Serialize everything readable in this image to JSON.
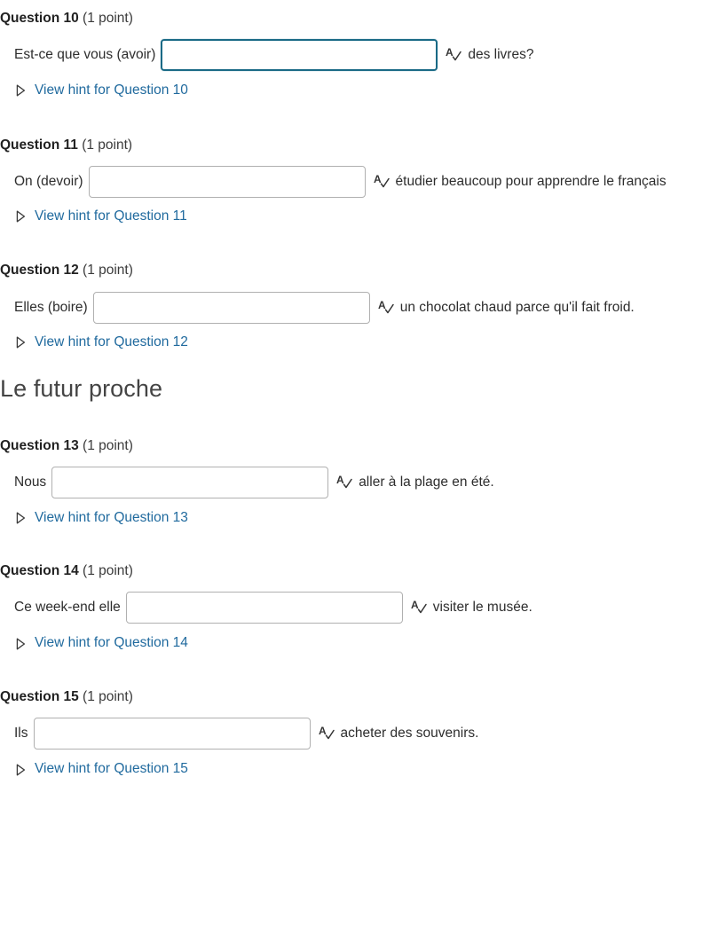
{
  "theme": {
    "background": "#ffffff",
    "text_color": "#2d2d2d",
    "link_color": "#206a9e",
    "heading_color": "#444444",
    "input_border": "#b0b0b0",
    "input_border_focus": "#1a6a86"
  },
  "icons": {
    "spellcheck": "spellcheck-icon",
    "hint_toggle": "triangle-right-icon"
  },
  "sections": [
    {
      "heading": null,
      "questions": [
        {
          "title": "Question 10",
          "points": "(1 point)",
          "prefix": "Est-ce que vous (avoir)",
          "suffix": "des livres?",
          "input_value": "",
          "input_width": 312,
          "focused": true,
          "hint_label": "View hint for Question 10"
        },
        {
          "title": "Question 11",
          "points": "(1 point)",
          "prefix": "On (devoir)",
          "suffix": "étudier beaucoup pour apprendre le français",
          "input_value": "",
          "input_width": 312,
          "focused": false,
          "hint_label": "View hint for Question 11"
        },
        {
          "title": "Question 12",
          "points": "(1 point)",
          "prefix": "Elles (boire)",
          "suffix": "un chocolat chaud parce qu'il fait froid.",
          "input_value": "",
          "input_width": 312,
          "focused": false,
          "hint_label": "View hint for Question 12"
        }
      ]
    },
    {
      "heading": "Le futur proche",
      "questions": [
        {
          "title": "Question 13",
          "points": "(1 point)",
          "prefix": "Nous",
          "suffix": "aller à la plage en été.",
          "input_value": "",
          "input_width": 312,
          "focused": false,
          "hint_label": "View hint for Question 13"
        },
        {
          "title": "Question 14",
          "points": "(1 point)",
          "prefix": "Ce week-end elle",
          "suffix": "visiter le musée.",
          "input_value": "",
          "input_width": 312,
          "focused": false,
          "hint_label": "View hint for Question 14"
        },
        {
          "title": "Question 15",
          "points": "(1 point)",
          "prefix": "Ils",
          "suffix": "acheter des souvenirs.",
          "input_value": "",
          "input_width": 312,
          "focused": false,
          "hint_label": "View hint for Question 15"
        }
      ]
    }
  ]
}
